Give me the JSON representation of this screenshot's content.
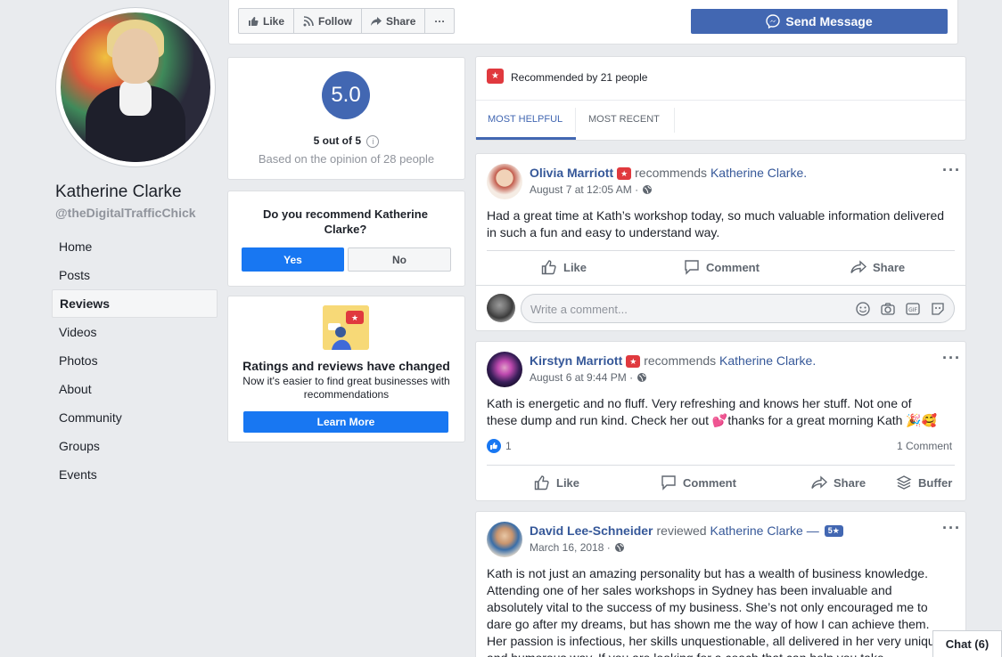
{
  "profile": {
    "name": "Katherine Clarke",
    "handle": "@theDigitalTrafficChick"
  },
  "nav": [
    {
      "label": "Home"
    },
    {
      "label": "Posts"
    },
    {
      "label": "Reviews",
      "active": true
    },
    {
      "label": "Videos"
    },
    {
      "label": "Photos"
    },
    {
      "label": "About"
    },
    {
      "label": "Community"
    },
    {
      "label": "Groups"
    },
    {
      "label": "Events"
    }
  ],
  "actions": {
    "like": "Like",
    "follow": "Follow",
    "share": "Share",
    "more": "···",
    "send_message": "Send Message"
  },
  "rating": {
    "score": "5.0",
    "out_of": "5 out of 5",
    "based_on": "Based on the opinion of 28 people"
  },
  "recommend": {
    "question": "Do you recommend Katherine Clarke?",
    "yes": "Yes",
    "no": "No"
  },
  "changed": {
    "title": "Ratings and reviews have changed",
    "subtitle": "Now it's easier to find great businesses with recommendations",
    "button": "Learn More"
  },
  "reviews_header": {
    "recommended_by": "Recommended by 21 people",
    "tabs": [
      "MOST HELPFUL",
      "MOST RECENT"
    ]
  },
  "posts": [
    {
      "author": "Olivia Marriott",
      "verb": "recommends",
      "target": "Katherine Clarke.",
      "date": "August 7 at 12:05 AM ·",
      "text": "Had a great time at Kath’s workshop today, so much valuable information delivered in such a fun and easy to understand way.",
      "actions": [
        "Like",
        "Comment",
        "Share"
      ],
      "comment_placeholder": "Write a comment..."
    },
    {
      "author": "Kirstyn Marriott",
      "verb": "recommends",
      "target": "Katherine Clarke.",
      "date": "August 6 at 9:44 PM ·",
      "text_line1": "Kath is energetic and no fluff. Very refreshing and knows her stuff. Not one of",
      "text_line2": "these dump and run kind. Check her out 💕thanks for a great morning Kath 🎉🥰",
      "reactions": "1",
      "comments": "1 Comment",
      "actions": [
        "Like",
        "Comment",
        "Share",
        "Buffer"
      ]
    },
    {
      "author": "David Lee-Schneider",
      "verb": "reviewed",
      "target": "Katherine Clarke —",
      "rating_badge": "5★",
      "date": "March 16, 2018 ·",
      "text": "Kath is not just an amazing personality but has a wealth of business knowledge. Attending one of her sales workshops in Sydney has been invaluable and absolutely vital to the success of my business. She’s not only encouraged me to dare go after my dreams, but has shown me the way of how I can achieve them. Her passion is infectious, her skills unquestionable, all delivered in her very unique and humorous way. If you are looking for a coach that can help you take"
    }
  ],
  "chat": {
    "label": "Chat (6)"
  },
  "colors": {
    "brand": "#4267b2",
    "cta": "#1877f2",
    "background": "#e9ebee",
    "recommend_red": "#e0393e"
  }
}
